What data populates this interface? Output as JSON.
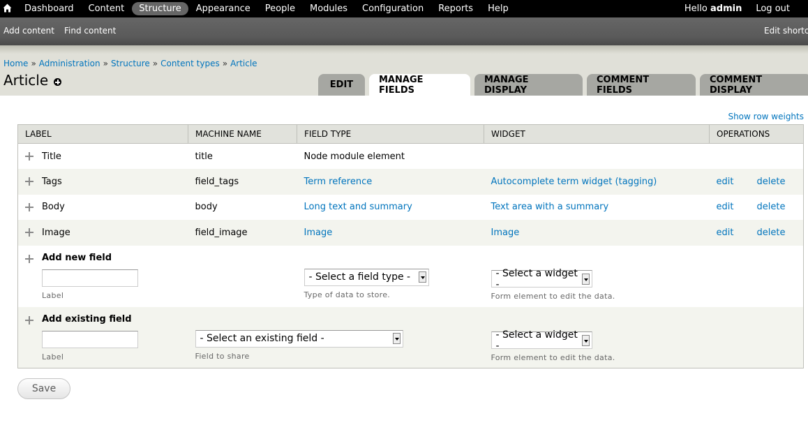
{
  "toolbar": {
    "menu": [
      "Dashboard",
      "Content",
      "Structure",
      "Appearance",
      "People",
      "Modules",
      "Configuration",
      "Reports",
      "Help"
    ],
    "active_menu": "Structure",
    "hello_prefix": "Hello ",
    "username": "admin",
    "logout": "Log out"
  },
  "shortcuts": {
    "items": [
      "Add content",
      "Find content"
    ],
    "edit": "Edit shortcuts"
  },
  "breadcrumb": [
    "Home",
    "Administration",
    "Structure",
    "Content types",
    "Article"
  ],
  "breadcrumb_separator": "»",
  "page_title": "Article",
  "tabs": [
    "EDIT",
    "MANAGE FIELDS",
    "MANAGE DISPLAY",
    "COMMENT FIELDS",
    "COMMENT DISPLAY"
  ],
  "active_tab": "MANAGE FIELDS",
  "show_row_weights": "Show row weights",
  "table": {
    "headers": [
      "LABEL",
      "MACHINE NAME",
      "FIELD TYPE",
      "WIDGET",
      "OPERATIONS"
    ],
    "rows": [
      {
        "label": "Title",
        "machine": "title",
        "type": "Node module element",
        "type_link": false,
        "widget": "",
        "edit": "",
        "delete": ""
      },
      {
        "label": "Tags",
        "machine": "field_tags",
        "type": "Term reference",
        "type_link": true,
        "widget": "Autocomplete term widget (tagging)",
        "edit": "edit",
        "delete": "delete"
      },
      {
        "label": "Body",
        "machine": "body",
        "type": "Long text and summary",
        "type_link": true,
        "widget": "Text area with a summary",
        "edit": "edit",
        "delete": "delete"
      },
      {
        "label": "Image",
        "machine": "field_image",
        "type": "Image",
        "type_link": true,
        "widget": "Image",
        "edit": "edit",
        "delete": "delete"
      }
    ],
    "add_new": {
      "title": "Add new field",
      "label_value": "",
      "label_desc": "Label",
      "type_select": "- Select a field type -",
      "type_desc": "Type of data to store.",
      "widget_select": "- Select a widget -",
      "widget_desc": "Form element to edit the data."
    },
    "add_existing": {
      "title": "Add existing field",
      "label_value": "",
      "label_desc": "Label",
      "field_select": "- Select an existing field -",
      "field_desc": "Field to share",
      "widget_select": "- Select a widget -",
      "widget_desc": "Form element to edit the data."
    }
  },
  "save_label": "Save"
}
